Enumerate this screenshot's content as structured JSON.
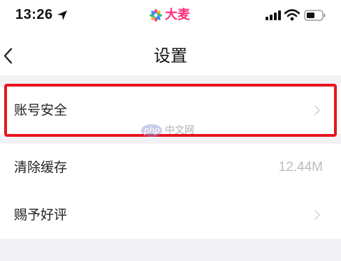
{
  "status_bar": {
    "time": "13:26",
    "app_name": "大麦",
    "brand_color": "#ff2d7a"
  },
  "nav": {
    "title": "设置",
    "back_icon": "chevron-left-icon"
  },
  "settings": {
    "items": [
      {
        "label": "账号安全",
        "value": "",
        "icon": "chevron-right-icon"
      },
      {
        "label": "清除缓存",
        "value": "12.44M"
      },
      {
        "label": "赐予好评",
        "value": "",
        "icon": "chevron-right-icon"
      }
    ]
  },
  "highlight_color": "#e8141e",
  "watermark": {
    "logo_text": "php",
    "text": "中文网"
  }
}
